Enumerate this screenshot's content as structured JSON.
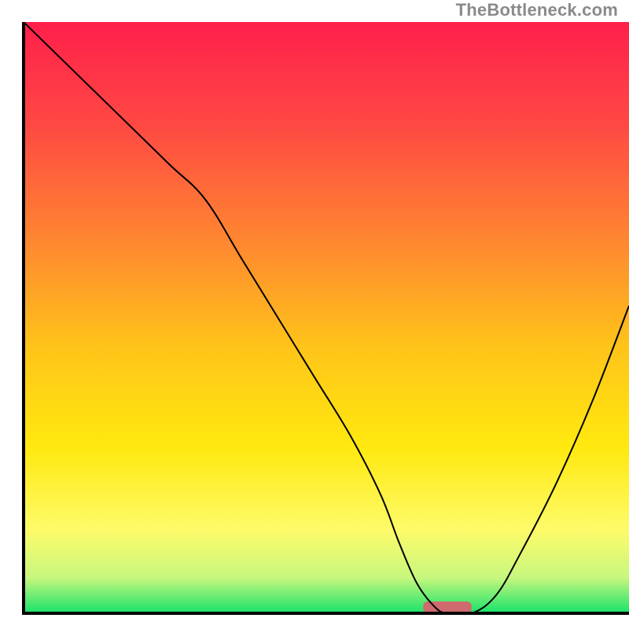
{
  "watermark": "TheBottleneck.com",
  "chart_data": {
    "type": "line",
    "title": "",
    "xlabel": "",
    "ylabel": "",
    "xlim": [
      0,
      100
    ],
    "ylim": [
      0,
      100
    ],
    "grid": false,
    "legend": false,
    "background_gradient_stops": [
      {
        "offset": 0.0,
        "color": "#ff1f4b"
      },
      {
        "offset": 0.18,
        "color": "#ff4a43"
      },
      {
        "offset": 0.38,
        "color": "#ff8a2f"
      },
      {
        "offset": 0.55,
        "color": "#ffc419"
      },
      {
        "offset": 0.72,
        "color": "#ffe90f"
      },
      {
        "offset": 0.86,
        "color": "#fdfb6a"
      },
      {
        "offset": 0.94,
        "color": "#c7f77e"
      },
      {
        "offset": 1.0,
        "color": "#17e36a"
      }
    ],
    "series": [
      {
        "name": "bottleneck-curve",
        "color": "#000000",
        "width": 2,
        "x": [
          0,
          8,
          16,
          24,
          30,
          36,
          42,
          48,
          54,
          59,
          62,
          65,
          68,
          70,
          74,
          78,
          82,
          88,
          94,
          100
        ],
        "y": [
          100,
          92,
          84,
          76,
          70,
          60,
          50,
          40,
          30,
          20,
          12,
          5,
          1,
          0,
          0,
          3,
          10,
          22,
          36,
          52
        ]
      }
    ],
    "axis_frame": {
      "color": "#000000",
      "width": 4,
      "sides": [
        "left",
        "bottom"
      ]
    },
    "marker": {
      "name": "optimal-range",
      "shape": "rounded-rect",
      "x_center": 70,
      "y": 0,
      "width_x_units": 8,
      "height_y_units": 2,
      "color": "#cf6a6f"
    }
  }
}
